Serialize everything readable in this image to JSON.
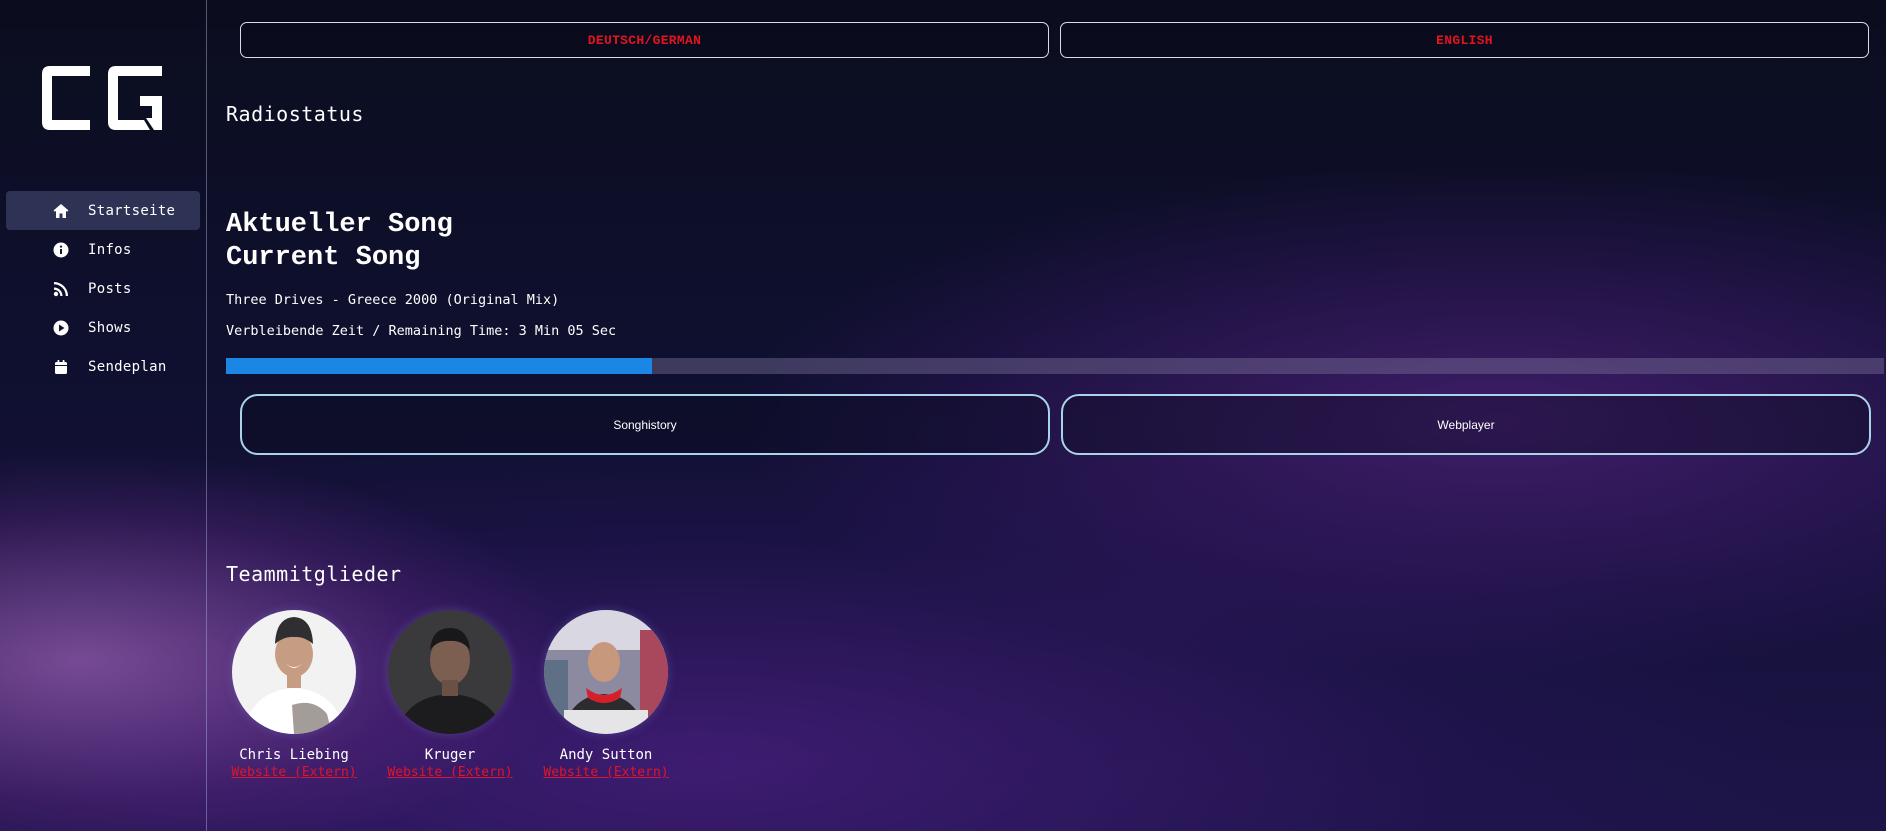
{
  "sidebar": {
    "logo_text": "CG",
    "items": [
      {
        "label": "Startseite",
        "icon": "home-icon",
        "active": true
      },
      {
        "label": "Infos",
        "icon": "info-icon",
        "active": false
      },
      {
        "label": "Posts",
        "icon": "rss-icon",
        "active": false
      },
      {
        "label": "Shows",
        "icon": "play-icon",
        "active": false
      },
      {
        "label": "Sendeplan",
        "icon": "calendar-icon",
        "active": false
      }
    ]
  },
  "language": {
    "german_label": "DEUTSCH/GERMAN",
    "english_label": "ENGLISH"
  },
  "radio": {
    "heading": "Radiostatus",
    "current_song_de": "Aktueller Song",
    "current_song_en": "Current Song",
    "track": "Three Drives - Greece 2000 (Original Mix)",
    "remaining": "Verbleibende Zeit / Remaining Time: 3 Min 05 Sec",
    "progress_percent": 25.7,
    "songhistory_label": "Songhistory",
    "webplayer_label": "Webplayer"
  },
  "team": {
    "heading": "Teammitglieder",
    "members": [
      {
        "name": "Chris Liebing",
        "link": "Website (Extern)"
      },
      {
        "name": "Kruger",
        "link": "Website (Extern)"
      },
      {
        "name": "Andy Sutton",
        "link": "Website (Extern)"
      }
    ]
  },
  "colors": {
    "accent_red": "#e2141f",
    "progress_blue": "#1b86e3",
    "button_border": "#a9d3e9"
  }
}
